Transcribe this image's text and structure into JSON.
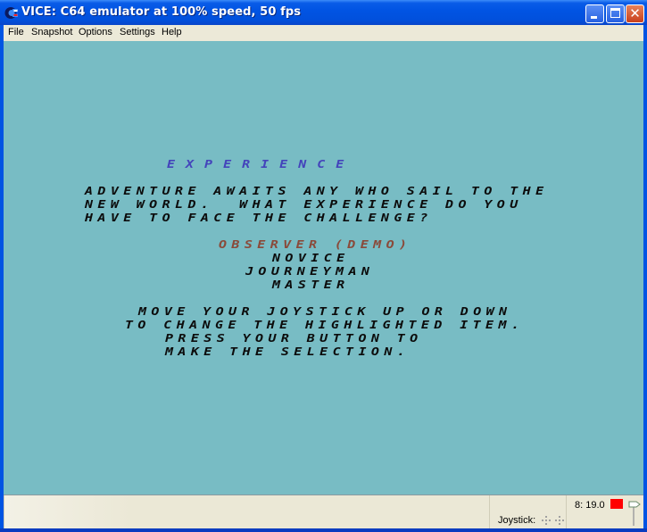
{
  "window": {
    "title": "VICE: C64 emulator at 100% speed, 50 fps",
    "icon": "vice-c64-icon",
    "controls": [
      "minimize",
      "maximize",
      "close"
    ]
  },
  "menubar": {
    "items": [
      {
        "label": "File"
      },
      {
        "label": "Snapshot"
      },
      {
        "label": "Options"
      },
      {
        "label": "Settings"
      },
      {
        "label": "Help"
      }
    ]
  },
  "c64_screen": {
    "background_color": "#78bcc4",
    "title": "EXPERIENCE",
    "title_color": "#4444bb",
    "intro_lines": [
      "ADVENTURE AWAITS ANY WHO SAIL TO THE",
      "NEW WORLD.  WHAT EXPERIENCE DO YOU",
      "HAVE TO FACE THE CHALLENGE?"
    ],
    "options": [
      {
        "label": "OBSERVER (DEMO)",
        "selected": true
      },
      {
        "label": "NOVICE",
        "selected": false
      },
      {
        "label": "JOURNEYMAN",
        "selected": false
      },
      {
        "label": "MASTER",
        "selected": false
      }
    ],
    "selected_color": "#8a4a3a",
    "instruction_lines": [
      "MOVE YOUR JOYSTICK UP OR DOWN",
      "TO CHANGE THE HIGHLIGHTED ITEM.",
      "PRESS YOUR BUTTON TO",
      "MAKE THE SELECTION."
    ]
  },
  "statusbar": {
    "drive_status": "8: 19.0",
    "drive_led_color": "#ff0000",
    "joystick_label": "Joystick:",
    "joystick_ports": [
      "port-1",
      "port-2"
    ]
  }
}
